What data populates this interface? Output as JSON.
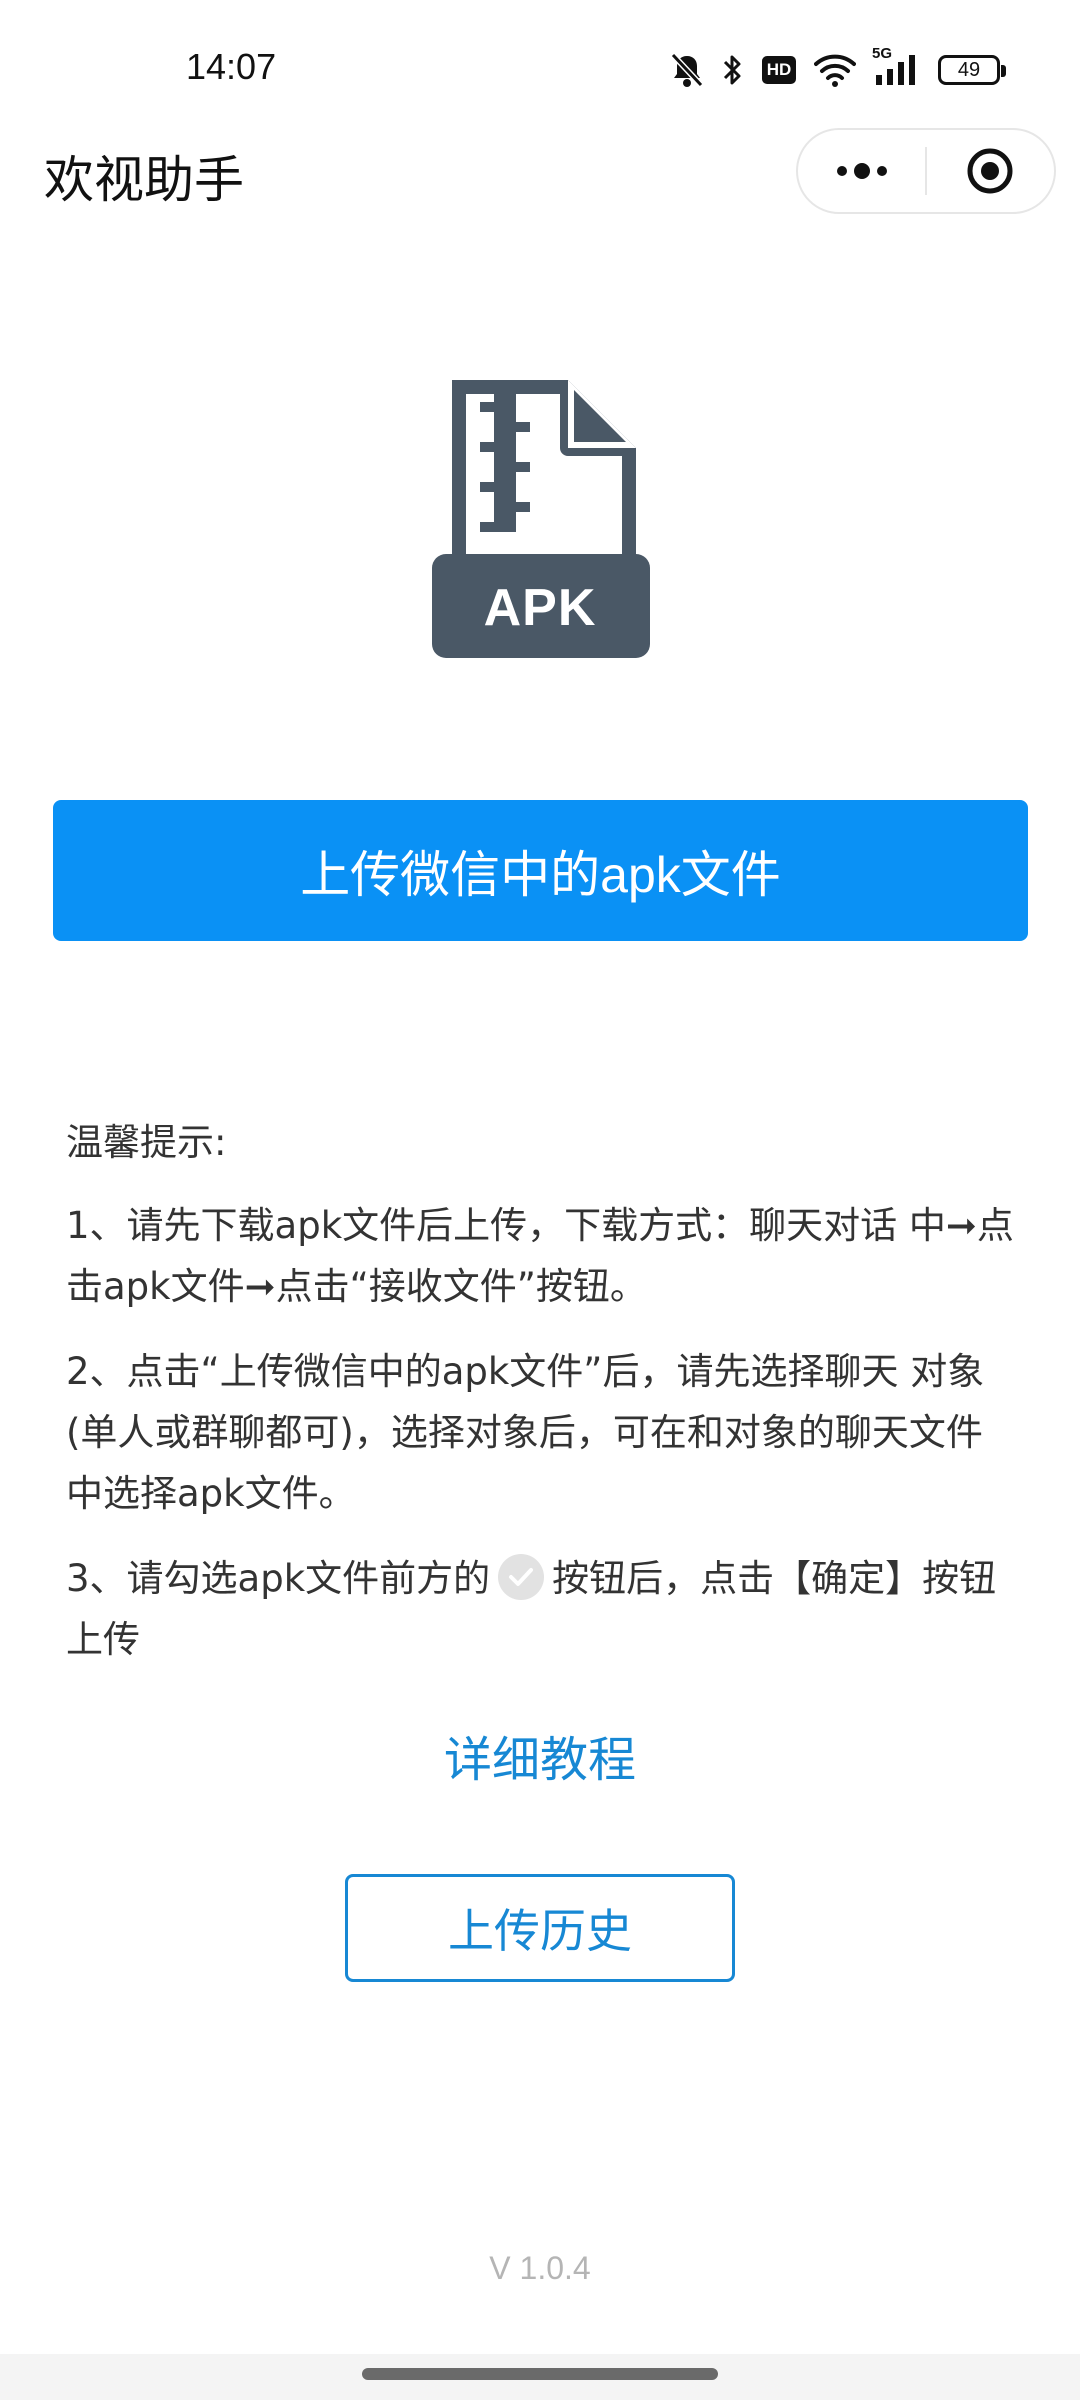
{
  "status_bar": {
    "time": "14:07",
    "network": "5G",
    "hd": "HD",
    "battery": "49"
  },
  "nav": {
    "title": "欢视助手",
    "more_icon": "more-dots-icon",
    "close_icon": "target-circle-icon"
  },
  "apk_icon": {
    "label": "APK",
    "color": "#4a5866"
  },
  "upload": {
    "label": "上传微信中的apk文件",
    "color": "#0a91f5"
  },
  "tips": {
    "title": "温馨提示:",
    "items": [
      "1、请先下载apk文件后上传，下载方式：聊天对话 中➞点击apk文件➞点击“接收文件”按钮。",
      "2、点击“上传微信中的apk文件”后，请先选择聊天 对象(单人或群聊都可)，选择对象后，可在和对象的聊天文件中选择apk文件。"
    ],
    "item3_before": "3、请勾选apk文件前方的",
    "item3_after": "按钮后，点击【确定】按钮上传"
  },
  "tutorial": {
    "label": "详细教程",
    "color": "#1788d4"
  },
  "history": {
    "label": "上传历史"
  },
  "version": "V 1.0.4"
}
